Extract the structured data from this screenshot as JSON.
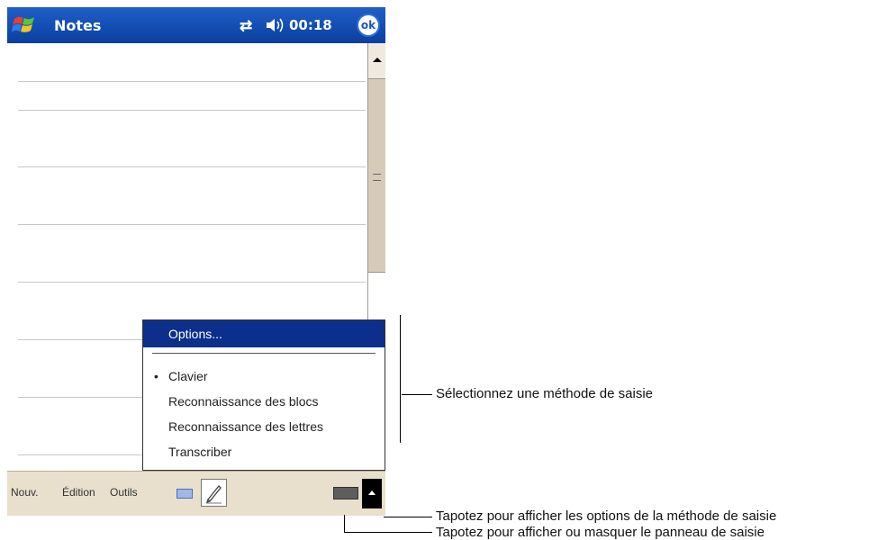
{
  "titlebar": {
    "app_title": "Notes",
    "time": "00:18",
    "ok_label": "ok"
  },
  "input_menu": {
    "options_label": "Options...",
    "items": [
      {
        "label": "Clavier",
        "selected": true
      },
      {
        "label": "Reconnaissance des blocs",
        "selected": false
      },
      {
        "label": "Reconnaissance des lettres",
        "selected": false
      },
      {
        "label": "Transcriber",
        "selected": false
      }
    ]
  },
  "menubar": {
    "new_label": "Nouv.",
    "edit_label": "Édition",
    "tools_label": "Outils"
  },
  "callouts": {
    "select_method": "Sélectionnez une méthode de saisie",
    "show_options": "Tapotez pour afficher les options de la méthode de saisie",
    "toggle_panel": "Tapotez pour afficher ou masquer le panneau de saisie"
  },
  "icons": {
    "start": "windows-flag-icon",
    "sync": "sync-arrows-icon",
    "volume": "speaker-icon",
    "keyboard_small": "keyboard-icon",
    "pen": "pen-icon",
    "input_panel": "keyboard-panel-icon",
    "input_arrow": "up-arrow-icon"
  },
  "colors": {
    "titlebar": "#1b57b8",
    "menu_highlight": "#0b2f8a",
    "bottombar": "#e8dfcc"
  }
}
